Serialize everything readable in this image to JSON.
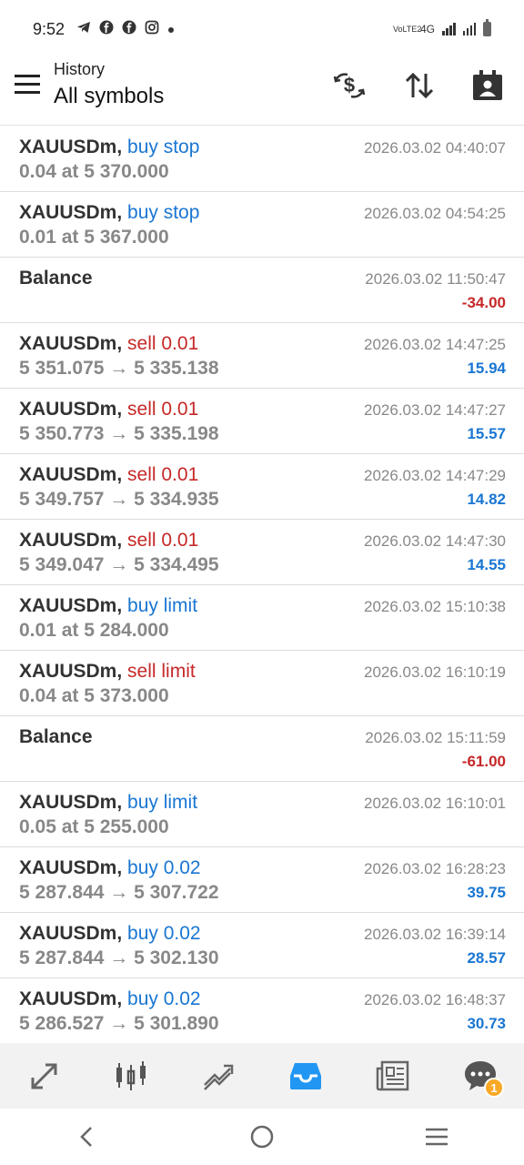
{
  "status_bar": {
    "time": "9:52",
    "network": "4G",
    "volte": "VoLTE2"
  },
  "header": {
    "small_title": "History",
    "title": "All symbols"
  },
  "icons": {
    "menu": "hamburger-menu-icon",
    "currency": "currency-exchange-icon",
    "sort": "sort-icon",
    "calendar": "calendar-period-icon"
  },
  "rows": [
    {
      "symbol": "XAUUSDm",
      "type": "buy stop",
      "type_color": "blue",
      "detail": "0.04 at 5 370.000",
      "time": "2026.03.02 04:40:07",
      "profit": ""
    },
    {
      "symbol": "XAUUSDm",
      "type": "buy stop",
      "type_color": "blue",
      "detail": "0.01 at 5 367.000",
      "time": "2026.03.02 04:54:25",
      "profit": ""
    },
    {
      "symbol": "Balance",
      "type": "",
      "type_color": "",
      "detail": "",
      "time": "2026.03.02 11:50:47",
      "profit": "-34.00",
      "profit_color": "red"
    },
    {
      "symbol": "XAUUSDm",
      "type": "sell 0.01",
      "type_color": "red",
      "detail": "5 351.075 → 5 335.138",
      "time": "2026.03.02 14:47:25",
      "profit": "15.94",
      "profit_color": "blue"
    },
    {
      "symbol": "XAUUSDm",
      "type": "sell 0.01",
      "type_color": "red",
      "detail": "5 350.773 → 5 335.198",
      "time": "2026.03.02 14:47:27",
      "profit": "15.57",
      "profit_color": "blue"
    },
    {
      "symbol": "XAUUSDm",
      "type": "sell 0.01",
      "type_color": "red",
      "detail": "5 349.757 → 5 334.935",
      "time": "2026.03.02 14:47:29",
      "profit": "14.82",
      "profit_color": "blue"
    },
    {
      "symbol": "XAUUSDm",
      "type": "sell 0.01",
      "type_color": "red",
      "detail": "5 349.047 → 5 334.495",
      "time": "2026.03.02 14:47:30",
      "profit": "14.55",
      "profit_color": "blue"
    },
    {
      "symbol": "XAUUSDm",
      "type": "buy limit",
      "type_color": "blue",
      "detail": "0.01 at 5 284.000",
      "time": "2026.03.02 15:10:38",
      "profit": ""
    },
    {
      "symbol": "XAUUSDm",
      "type": "sell limit",
      "type_color": "red",
      "detail": "0.04 at 5 373.000",
      "time": "2026.03.02 16:10:19",
      "profit": ""
    },
    {
      "symbol": "Balance",
      "type": "",
      "type_color": "",
      "detail": "",
      "time": "2026.03.02 15:11:59",
      "profit": "-61.00",
      "profit_color": "red"
    },
    {
      "symbol": "XAUUSDm",
      "type": "buy limit",
      "type_color": "blue",
      "detail": "0.05 at 5 255.000",
      "time": "2026.03.02 16:10:01",
      "profit": ""
    },
    {
      "symbol": "XAUUSDm",
      "type": "buy 0.02",
      "type_color": "blue",
      "detail": "5 287.844 → 5 307.722",
      "time": "2026.03.02 16:28:23",
      "profit": "39.75",
      "profit_color": "blue"
    },
    {
      "symbol": "XAUUSDm",
      "type": "buy 0.02",
      "type_color": "blue",
      "detail": "5 287.844 → 5 302.130",
      "time": "2026.03.02 16:39:14",
      "profit": "28.57",
      "profit_color": "blue"
    },
    {
      "symbol": "XAUUSDm",
      "type": "buy 0.02",
      "type_color": "blue",
      "detail": "5 286.527 → 5 301.890",
      "time": "2026.03.02 16:48:37",
      "profit": "30.73",
      "profit_color": "blue"
    }
  ],
  "bottom_nav": [
    {
      "name": "quotes-icon",
      "active": false
    },
    {
      "name": "chart-candles-icon",
      "active": false
    },
    {
      "name": "trade-icon",
      "active": false
    },
    {
      "name": "history-inbox-icon",
      "active": true
    },
    {
      "name": "news-icon",
      "active": false
    },
    {
      "name": "messages-icon",
      "active": false,
      "badge": "1"
    }
  ],
  "colors": {
    "accent": "#1976d2",
    "loss": "#c62828",
    "active_nav": "#2196f3",
    "badge": "#f9a825"
  }
}
